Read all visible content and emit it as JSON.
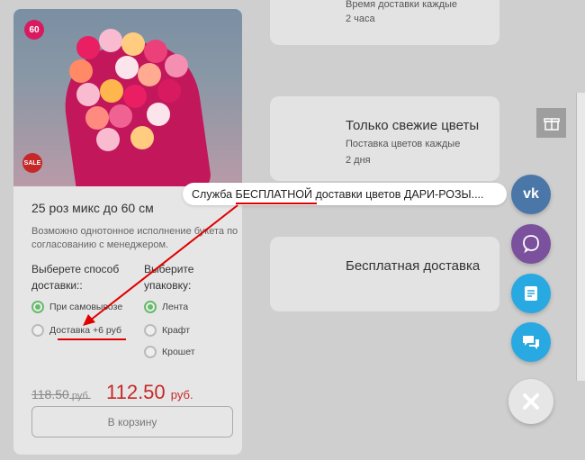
{
  "product": {
    "discount_badge": "60",
    "sale_badge": "SALE",
    "title": "25 роз микс до 60 см",
    "description": "Возможно однотонное исполнение букета по согласованию с менеджером.",
    "delivery_title_1": "Выберете способ",
    "delivery_title_2": "доставки::",
    "delivery_options": [
      "При самовывозе",
      "Доставка +6 руб"
    ],
    "delivery_selected": "При самовывозе",
    "packaging_title_1": "Выберите",
    "packaging_title_2": "упаковку:",
    "packaging_options": [
      "Лента",
      "Крафт",
      "Крошет"
    ],
    "packaging_selected": "Лента",
    "old_price": "118.50",
    "new_price": "112.50",
    "currency": "руб.",
    "cart_button": "В корзину"
  },
  "features": [
    {
      "heading": "",
      "sub1": "Время доставки каждые",
      "sub2": "2 часа"
    },
    {
      "heading": "Только свежие цветы",
      "sub1": "Поставка цветов каждые",
      "sub2": "2 дня"
    },
    {
      "heading": "Бесплатная доставка",
      "sub1": "",
      "sub2": ""
    }
  ],
  "tooltip": {
    "text": "Служба БЕСПЛАТНОЙ доставки цветов ДАРИ-РОЗЫ...."
  },
  "colors": {
    "accent_red": "#c62828",
    "vk": "#4a76a8",
    "viber": "#7b519d",
    "docs": "#29a9e1",
    "chat": "#29a9e1",
    "annotation": "#e00000"
  },
  "icons": [
    "vk-icon",
    "viber-icon",
    "document-icon",
    "chat-icon",
    "close-icon",
    "gift-icon"
  ]
}
